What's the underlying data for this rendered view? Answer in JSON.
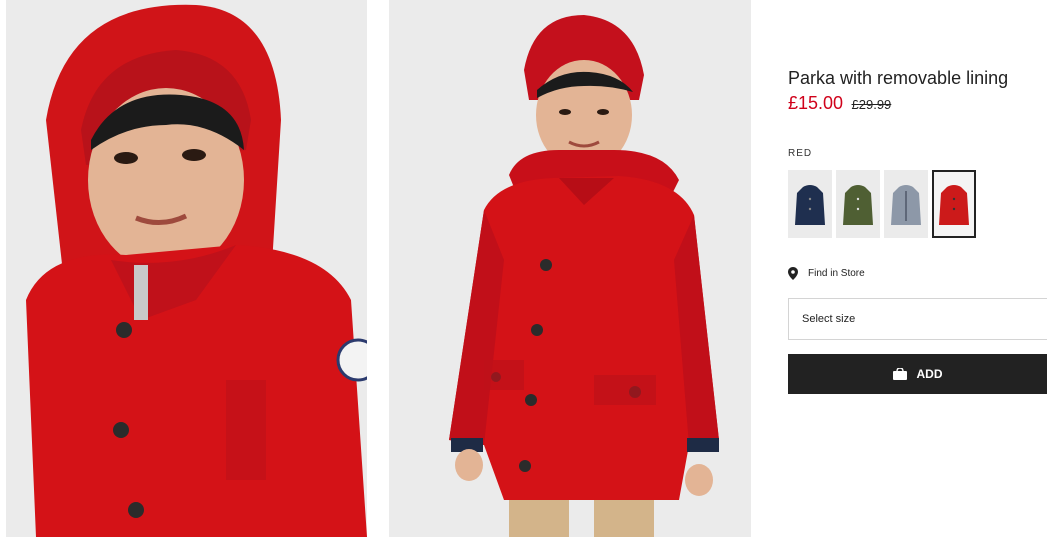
{
  "product": {
    "title": "Parka with removable lining",
    "price_now": "£15.00",
    "price_was": "£29.99",
    "color_label": "RED",
    "accent_color": "#d0021b"
  },
  "swatches": [
    {
      "name": "navy",
      "color": "#1f2f4f"
    },
    {
      "name": "khaki",
      "color": "#4f5f33"
    },
    {
      "name": "grey",
      "color": "#8d98a8"
    },
    {
      "name": "red",
      "color": "#cc1a1a",
      "selected": true
    }
  ],
  "store": {
    "label": "Find in Store",
    "icon": "location-pin-icon"
  },
  "size_select": {
    "label": "Select size"
  },
  "add_button": {
    "label": "ADD",
    "icon": "shopping-bag-icon"
  },
  "images": [
    {
      "name": "hooded-closeup",
      "jacket_color": "#d41217"
    },
    {
      "name": "full-body",
      "jacket_color": "#d41217"
    }
  ]
}
